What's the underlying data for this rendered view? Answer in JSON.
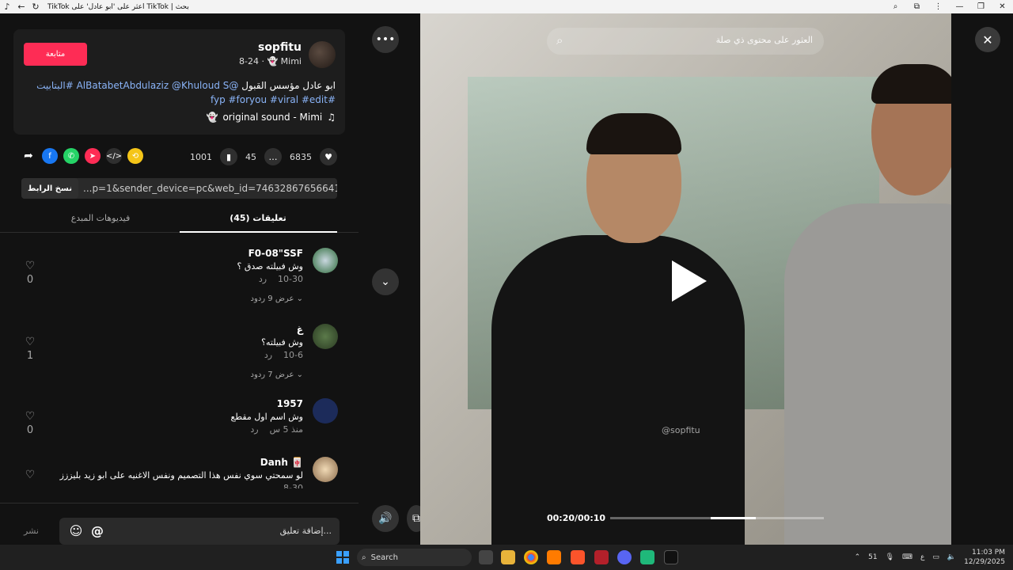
{
  "window": {
    "title": "TikTok اعثر على 'ابو عادل' على TikTok | بحث"
  },
  "profile": {
    "username": "sopfitu",
    "display_name": "Mimi",
    "date": "8-24",
    "follow_label": "متابعة",
    "description_text": "ابو عادل مؤسس القبول",
    "description_tags": "@AlBatabetAbdulaziz @Khuloud S #البتابيت",
    "description_tags2": "#fyp #foryou #viral #edit",
    "sound": "original sound - Mimi"
  },
  "stats": {
    "likes": "6835",
    "comments": "45",
    "saves": "1001"
  },
  "share_icons": [
    "share-arrow-icon",
    "facebook-icon",
    "whatsapp-icon",
    "telegram-icon",
    "embed-icon",
    "repost-icon"
  ],
  "link": {
    "url": "...p=1&sender_device=pc&web_id=7463286765664175624",
    "copy_label": "نسخ الرابط"
  },
  "tabs": {
    "comments": "تعليقات (45)",
    "creator_videos": "فيديوهات المبدع"
  },
  "comments": [
    {
      "name": "F0-08\"SSF",
      "text": "وش فبيلته صدق ؟",
      "date": "10-30",
      "reply": "رد",
      "replies": "عرض 9 ردود",
      "likes": "0"
    },
    {
      "name": "غ",
      "text": "وش فبيلته؟",
      "date": "10-6",
      "reply": "رد",
      "replies": "عرض 7 ردود",
      "likes": "1"
    },
    {
      "name": "1957",
      "text": "وش اسم اول مقطع",
      "date": "منذ 5 س",
      "reply": "رد",
      "replies": "",
      "likes": "0"
    },
    {
      "name": "Danh 🀄",
      "text": "لو سمحتي سوي نفس هذا التصميم ونفس الاغنيه على ابو زيد بليززز",
      "date": "8-30",
      "reply": "",
      "replies": "",
      "likes": ""
    }
  ],
  "composer": {
    "placeholder": "إضافة تعليق...",
    "post_label": "نشر",
    "mention": "@",
    "emoji": "☺"
  },
  "video": {
    "search_placeholder": "العثور على محتوى ذي صلة",
    "watermark": "@sopfitu",
    "time": "00:20/00:10",
    "progress": 0.68
  },
  "taskbar": {
    "search": "Search",
    "temp": "51",
    "time": "11:03 PM",
    "date": "12/29/2025",
    "lang": "ع"
  },
  "colors": {
    "accent": "#fe2c55",
    "tag": "#8ab4f8"
  }
}
